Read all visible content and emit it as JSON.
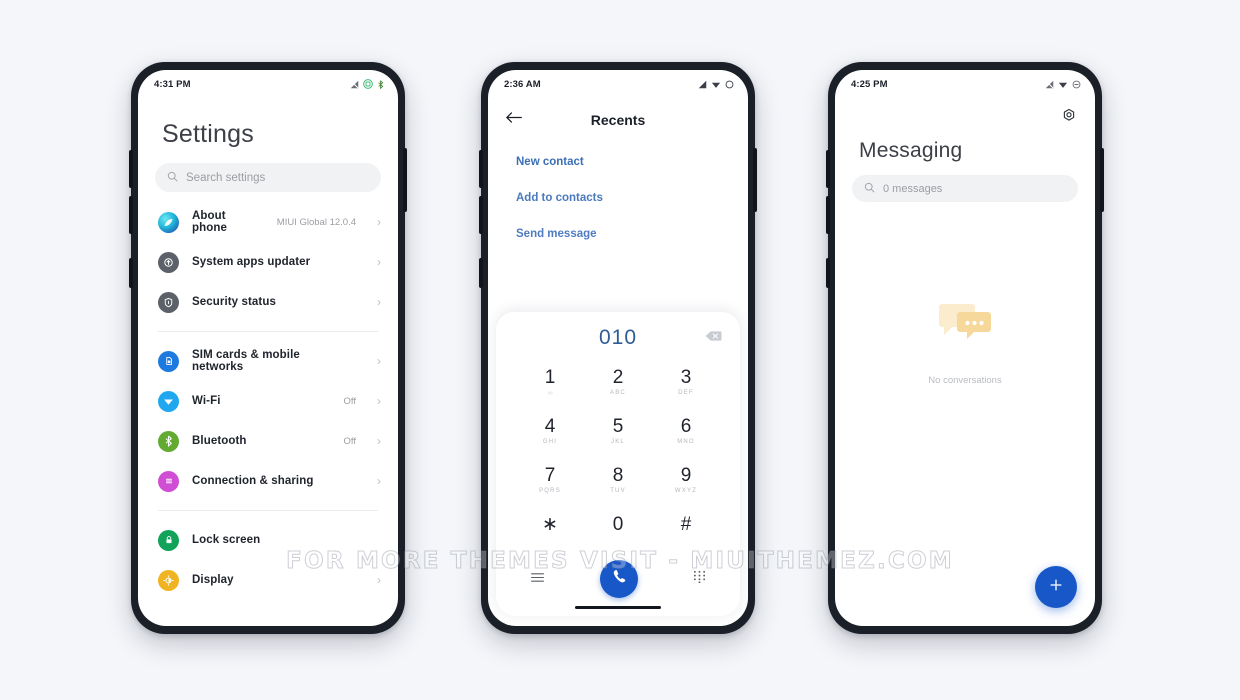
{
  "watermark": {
    "text": "FOR MORE THEMES VISIT - MIUITHEMEZ.COM"
  },
  "colors": {
    "page_bg": "#f4f6fa",
    "accent_blue": "#1757c8",
    "link_blue": "#3d6fb5",
    "dialer_number": "#2f5c96",
    "frame": "#1b1f28"
  },
  "phones": {
    "settings": {
      "status": {
        "time": "4:31 PM",
        "icons": [
          "signal-off-icon",
          "data-saver-icon",
          "bluetooth-small-icon"
        ]
      },
      "title": "Settings",
      "search": {
        "placeholder": "Search settings",
        "icon": "search-icon"
      },
      "groups": [
        {
          "items": [
            {
              "label": "About phone",
              "value": "MIUI Global 12.0.4",
              "icon": "about-phone-icon",
              "color": "#12b5cf",
              "chevron": "›"
            },
            {
              "label": "System apps updater",
              "value": "",
              "icon": "system-updater-icon",
              "color": "#5c6068",
              "chevron": "›"
            },
            {
              "label": "Security status",
              "value": "",
              "icon": "security-shield-icon",
              "color": "#5c6068",
              "chevron": "›"
            }
          ]
        },
        {
          "items": [
            {
              "label": "SIM cards & mobile networks",
              "value": "",
              "icon": "sim-card-icon",
              "color": "#1f7ae0",
              "chevron": "›"
            },
            {
              "label": "Wi-Fi",
              "value": "Off",
              "icon": "wifi-icon",
              "color": "#21a7ef",
              "chevron": "›"
            },
            {
              "label": "Bluetooth",
              "value": "Off",
              "icon": "bluetooth-icon",
              "color": "#63aa33",
              "chevron": "›"
            },
            {
              "label": "Connection & sharing",
              "value": "",
              "icon": "connection-sharing-icon",
              "color": "#cf4ed4",
              "chevron": "›"
            }
          ]
        },
        {
          "items": [
            {
              "label": "Lock screen",
              "value": "",
              "icon": "lock-icon",
              "color": "#12a35a",
              "chevron": ""
            },
            {
              "label": "Display",
              "value": "",
              "icon": "display-brightness-icon",
              "color": "#f0b422",
              "chevron": "›"
            }
          ]
        }
      ]
    },
    "dialer": {
      "status": {
        "time": "2:36 AM",
        "icons": [
          "signal-icon",
          "wifi-icon",
          "circle-icon"
        ]
      },
      "back_icon": "back-arrow-icon",
      "title": "Recents",
      "links": [
        "New contact",
        "Add to contacts",
        "Send message"
      ],
      "number": "010",
      "backspace_icon": "backspace-icon",
      "keys": [
        {
          "digit": "1",
          "sub": "∞"
        },
        {
          "digit": "2",
          "sub": "ABC"
        },
        {
          "digit": "3",
          "sub": "DEF"
        },
        {
          "digit": "4",
          "sub": "GHI"
        },
        {
          "digit": "5",
          "sub": "JKL"
        },
        {
          "digit": "6",
          "sub": "MNO"
        },
        {
          "digit": "7",
          "sub": "PQRS"
        },
        {
          "digit": "8",
          "sub": "TUV"
        },
        {
          "digit": "9",
          "sub": "WXYZ"
        },
        {
          "digit": "∗",
          "sub": ""
        },
        {
          "digit": "0",
          "sub": ""
        },
        {
          "digit": "#",
          "sub": ""
        }
      ],
      "bottom": {
        "menu_icon": "menu-icon",
        "call_icon": "call-icon",
        "keypad_icon": "keypad-icon"
      }
    },
    "messaging": {
      "status": {
        "time": "4:25 PM",
        "icons": [
          "signal-off-icon",
          "wifi-icon",
          "dnd-icon"
        ]
      },
      "gear_icon": "gear-icon",
      "title": "Messaging",
      "search": {
        "placeholder": "0 messages",
        "icon": "search-icon"
      },
      "empty": {
        "illustration": "chat-bubbles-icon",
        "label": "No conversations"
      },
      "fab": {
        "icon": "plus-icon"
      }
    }
  }
}
